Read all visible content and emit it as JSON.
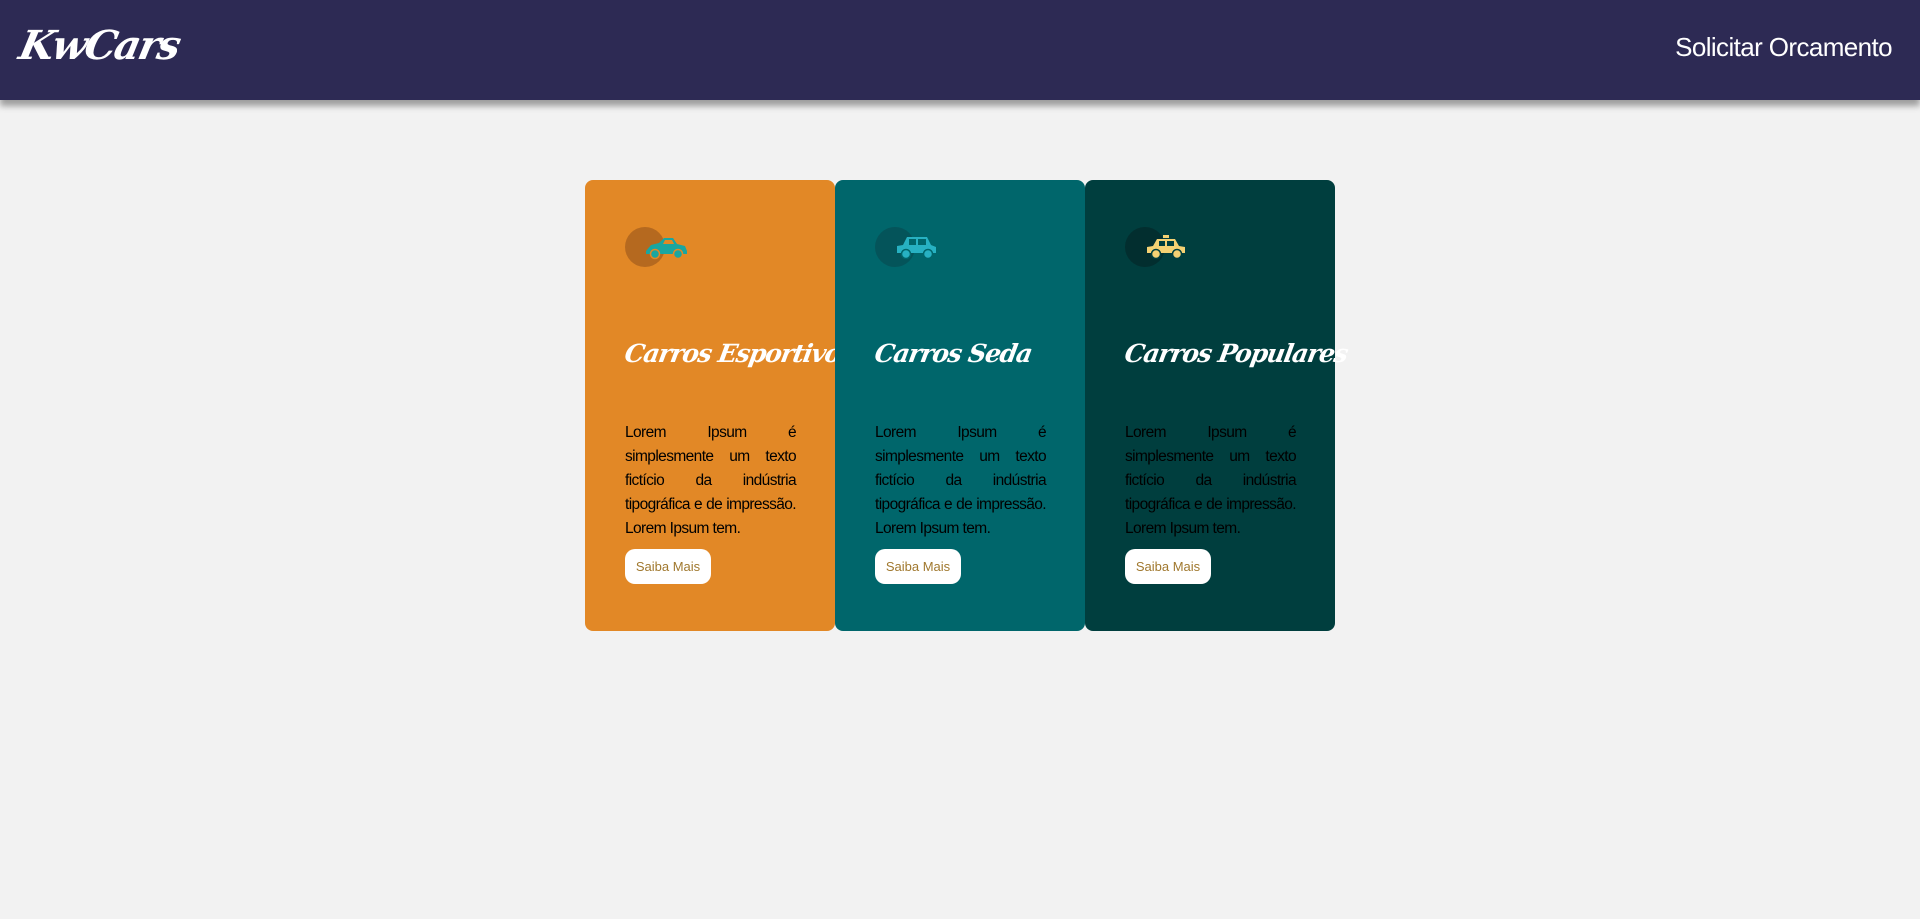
{
  "header": {
    "logo": "KwCars",
    "nav_link": "Solicitar Orcamento"
  },
  "colors": {
    "header_bg": "#2d2a54",
    "page_bg": "#f2f2f2",
    "card_orange": "#e28826",
    "card_teal": "#00666b",
    "card_dark": "#003e3e",
    "button_text": "#a0782e"
  },
  "cards": [
    {
      "icon": "sports-car-icon",
      "title": "Carros Esportivos",
      "text": "Lorem Ipsum é simplesmente um texto fictício da indústria tipográfica e de impressão. Lorem Ipsum tem.",
      "button": "Saiba Mais"
    },
    {
      "icon": "suv-icon",
      "title": "Carros Seda",
      "text": "Lorem Ipsum é simplesmente um texto fictício da indústria tipográfica e de impressão. Lorem Ipsum tem.",
      "button": "Saiba Mais"
    },
    {
      "icon": "taxi-car-icon",
      "title": "Carros Populares",
      "text": "Lorem Ipsum é simplesmente um texto fictício da indústria tipográfica e de impressão. Lorem Ipsum tem.",
      "button": "Saiba Mais"
    }
  ]
}
